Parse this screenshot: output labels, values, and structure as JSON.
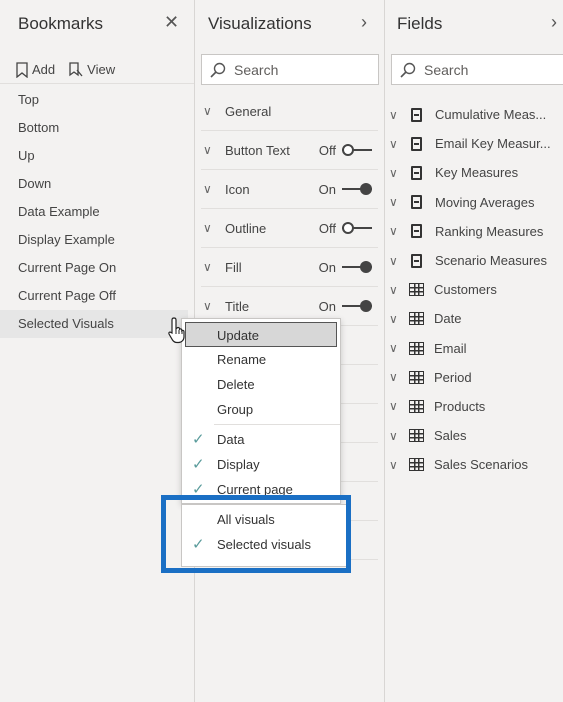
{
  "bookmarks": {
    "title": "Bookmarks",
    "add_label": "Add",
    "view_label": "View",
    "items": [
      "Top",
      "Bottom",
      "Up",
      "Down",
      "Data Example",
      "Display Example",
      "Current Page On",
      "Current Page Off",
      "Selected Visuals"
    ]
  },
  "visualizations": {
    "title": "Visualizations",
    "search_placeholder": "Search",
    "sections": [
      {
        "label": "General",
        "state": ""
      },
      {
        "label": "Button Text",
        "state": "Off"
      },
      {
        "label": "Icon",
        "state": "On"
      },
      {
        "label": "Outline",
        "state": "Off"
      },
      {
        "label": "Fill",
        "state": "On"
      },
      {
        "label": "Title",
        "state": "On"
      }
    ]
  },
  "fields": {
    "title": "Fields",
    "search_placeholder": "Search",
    "items": [
      {
        "label": "Cumulative Meas...",
        "icon": "calculator-icon"
      },
      {
        "label": "Email Key Measur...",
        "icon": "calculator-icon"
      },
      {
        "label": "Key Measures",
        "icon": "calculator-icon"
      },
      {
        "label": "Moving Averages",
        "icon": "calculator-icon"
      },
      {
        "label": "Ranking Measures",
        "icon": "calculator-icon"
      },
      {
        "label": "Scenario Measures",
        "icon": "calculator-icon"
      },
      {
        "label": "Customers",
        "icon": "table-icon"
      },
      {
        "label": "Date",
        "icon": "table-icon"
      },
      {
        "label": "Email",
        "icon": "table-icon"
      },
      {
        "label": "Period",
        "icon": "table-icon"
      },
      {
        "label": "Products",
        "icon": "table-icon"
      },
      {
        "label": "Sales",
        "icon": "table-icon"
      },
      {
        "label": "Sales Scenarios",
        "icon": "table-icon"
      }
    ]
  },
  "context_menu": {
    "update": "Update",
    "rename": "Rename",
    "delete": "Delete",
    "group": "Group",
    "data": "Data",
    "display": "Display",
    "current_page": "Current page",
    "all_visuals": "All visuals",
    "selected_visuals": "Selected visuals"
  },
  "colors": {
    "highlight_border": "#1a6fc4",
    "check_color": "#5b9c9c"
  }
}
